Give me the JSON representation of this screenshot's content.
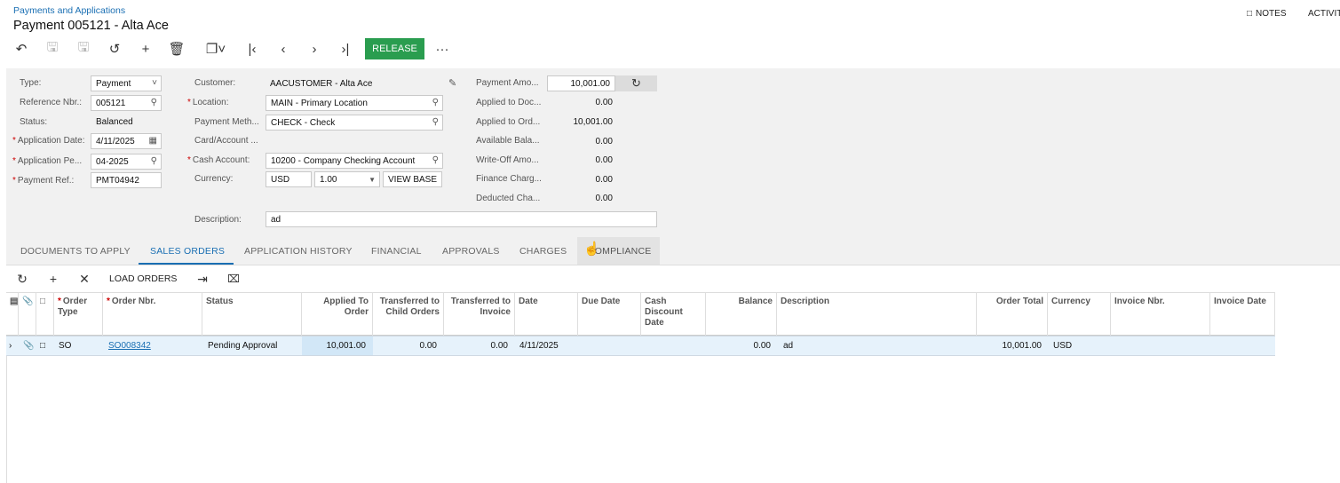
{
  "header": {
    "breadcrumb": "Payments and Applications",
    "title": "Payment 005121 - Alta Ace",
    "notes_label": "NOTES",
    "activities_label": "ACTIVITI"
  },
  "toolbar": {
    "release_label": "RELEASE",
    "more_label": "···"
  },
  "form": {
    "type": {
      "label": "Type:",
      "value": "Payment"
    },
    "reference": {
      "label": "Reference Nbr.:",
      "value": "005121"
    },
    "status": {
      "label": "Status:",
      "value": "Balanced"
    },
    "app_date": {
      "label": "Application Date:",
      "value": "4/11/2025"
    },
    "app_period": {
      "label": "Application Pe...",
      "value": "04-2025"
    },
    "payment_ref": {
      "label": "Payment Ref.:",
      "value": "PMT04942"
    },
    "customer": {
      "label": "Customer:",
      "value": "AACUSTOMER - Alta Ace"
    },
    "location": {
      "label": "Location:",
      "value": "MAIN - Primary Location"
    },
    "payment_method": {
      "label": "Payment Meth...",
      "value": "CHECK - Check"
    },
    "card_account": {
      "label": "Card/Account ..."
    },
    "cash_account": {
      "label": "Cash Account:",
      "value": "10200 - Company Checking Account"
    },
    "currency": {
      "label": "Currency:",
      "value": "USD",
      "rate": "1.00",
      "view_base_label": "VIEW BASE"
    },
    "description": {
      "label": "Description:",
      "value": "ad"
    },
    "payment_amount": {
      "label": "Payment Amo...",
      "value": "10,001.00"
    },
    "applied_doc": {
      "label": "Applied to Doc...",
      "value": "0.00"
    },
    "applied_order": {
      "label": "Applied to Ord...",
      "value": "10,001.00"
    },
    "available_balance": {
      "label": "Available Bala...",
      "value": "0.00"
    },
    "write_off": {
      "label": "Write-Off Amo...",
      "value": "0.00"
    },
    "finance_charges": {
      "label": "Finance Charg...",
      "value": "0.00"
    },
    "deducted_charges": {
      "label": "Deducted Cha...",
      "value": "0.00"
    }
  },
  "tabs": [
    {
      "label": "DOCUMENTS TO APPLY"
    },
    {
      "label": "SALES ORDERS"
    },
    {
      "label": "APPLICATION HISTORY"
    },
    {
      "label": "FINANCIAL"
    },
    {
      "label": "APPROVALS"
    },
    {
      "label": "CHARGES"
    },
    {
      "label": "COMPLIANCE"
    }
  ],
  "grid_toolbar": {
    "load_orders_label": "LOAD ORDERS"
  },
  "grid": {
    "columns": {
      "order_type": "Order Type",
      "order_nbr": "Order Nbr.",
      "status": "Status",
      "applied_to_order": "Applied To Order",
      "transferred_child": "Transferred to Child Orders",
      "transferred_invoice": "Transferred to Invoice",
      "date": "Date",
      "due_date": "Due Date",
      "cash_discount_date": "Cash Discount Date",
      "balance": "Balance",
      "description": "Description",
      "order_total": "Order Total",
      "currency": "Currency",
      "invoice_nbr": "Invoice Nbr.",
      "invoice_date": "Invoice Date"
    },
    "rows": [
      {
        "order_type": "SO",
        "order_nbr": "SO008342",
        "status": "Pending Approval",
        "applied_to_order": "10,001.00",
        "transferred_child": "0.00",
        "transferred_invoice": "0.00",
        "date": "4/11/2025",
        "balance": "0.00",
        "description": "ad",
        "order_total": "10,001.00",
        "currency": "USD"
      }
    ]
  },
  "colors": {
    "accent": "#1a6fb3",
    "release": "#2a9d4f",
    "row_selected": "#e6f2fb"
  }
}
